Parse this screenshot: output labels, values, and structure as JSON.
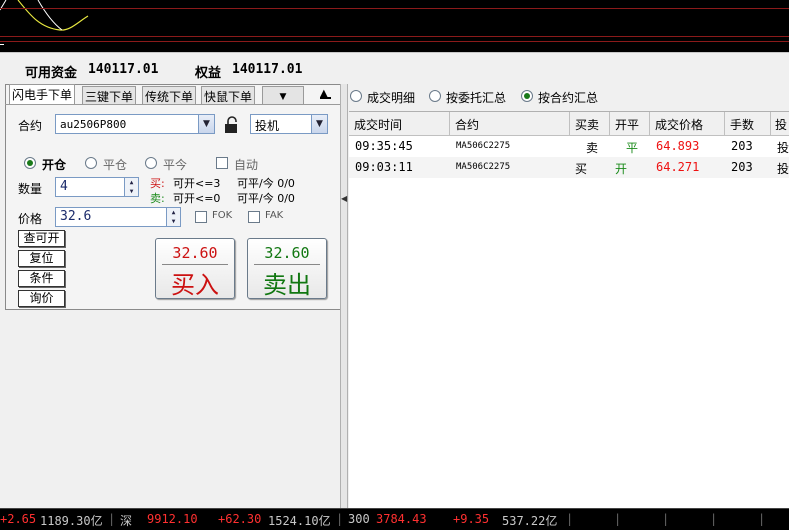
{
  "colors": {
    "red": "#ff4040",
    "green": "#1a8a1a",
    "buy_red": "#cc1111",
    "sell_green": "#117711"
  },
  "account": {
    "available_label": "可用资金",
    "available_value": "140117.01",
    "equity_label": "权益",
    "equity_value": "140117.01"
  },
  "tabs": [
    "闪电手下单",
    "三键下单",
    "传统下单",
    "快鼠下单"
  ],
  "tab_dropdown_icon": "chevron-down-icon",
  "form": {
    "contract_label": "合约",
    "contract_value": "au2506P800",
    "lock_icon": "unlock-icon",
    "hedge_value": "投机",
    "open_label": "开仓",
    "close_label": "平仓",
    "close_today_label": "平今",
    "auto_label": "自动",
    "qty_label": "数量",
    "qty_value": "4",
    "buy_label": "买:",
    "buy_open": "可开<=3",
    "buy_close": "可平/今 0/0",
    "sell_label": "卖:",
    "sell_open": "可开<=0",
    "sell_close": "可平/今 0/0",
    "price_label": "价格",
    "price_value": "32.6",
    "fok_label": "FOK",
    "fak_label": "FAK"
  },
  "side_buttons": [
    "查可开",
    "复位",
    "条件",
    "询价"
  ],
  "buy_button": {
    "price": "32.60",
    "label": "买入"
  },
  "sell_button": {
    "price": "32.60",
    "label": "卖出"
  },
  "view_options": {
    "detail": "成交明细",
    "by_order": "按委托汇总",
    "by_contract": "按合约汇总",
    "selected": "by_contract"
  },
  "table": {
    "headers": [
      "成交时间",
      "合约",
      "买卖",
      "开平",
      "成交价格",
      "手数",
      "投"
    ],
    "rows": [
      {
        "time": "09:35:45",
        "contract": "MA506C2275",
        "side": "卖",
        "oc": "平",
        "price": "64.893",
        "qty": "203",
        "type": "投"
      },
      {
        "time": "09:03:11",
        "contract": "MA506C2275",
        "side": "买",
        "oc": "开",
        "price": "64.271",
        "qty": "203",
        "type": "投"
      }
    ]
  },
  "status": {
    "s1_change": "+2.65",
    "s1_amount": "1189.30亿",
    "s2_name": "深",
    "s2_value": "9912.10",
    "s2_change": "+62.30",
    "s2_amount": "1524.10亿",
    "s3_name": "300",
    "s3_value": "3784.43",
    "s3_change": "+9.35",
    "s3_amount": "537.22亿"
  }
}
